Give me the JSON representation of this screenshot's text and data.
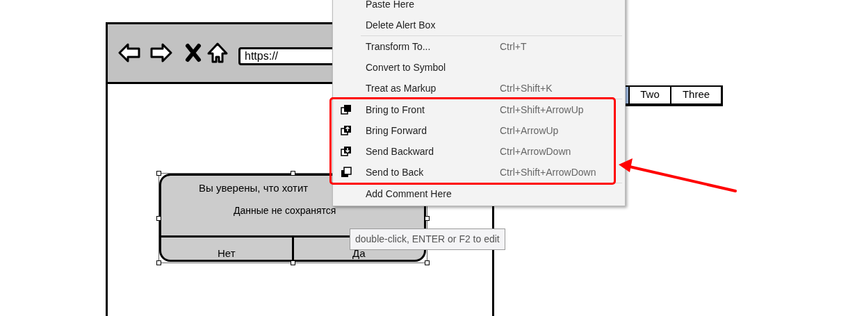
{
  "browser_mockup": {
    "url": "https://",
    "tabs": [
      {
        "selected": true
      },
      {
        "label": "Two",
        "selected": false
      },
      {
        "label": "Three",
        "selected": false
      }
    ]
  },
  "alert_box": {
    "selected": true,
    "title": "Вы уверены, что хотит",
    "message": "Данные не сохранятся",
    "buttons": [
      "Нет",
      "Да"
    ]
  },
  "context_menu": {
    "groups": [
      {
        "highlighted": false,
        "items": [
          {
            "label": "Paste Here",
            "icon": false
          },
          {
            "label": "Delete Alert Box",
            "icon": false
          }
        ]
      },
      {
        "highlighted": false,
        "items": [
          {
            "label": "Transform To...",
            "shortcut": "Ctrl+T",
            "icon": false
          },
          {
            "label": "Convert to Symbol",
            "icon": false
          },
          {
            "label": "Treat as Markup",
            "shortcut": "Ctrl+Shift+K",
            "icon": false
          }
        ]
      },
      {
        "highlighted": true,
        "items": [
          {
            "label": "Bring to Front",
            "shortcut": "Ctrl+Shift+ArrowUp",
            "icon": true
          },
          {
            "label": "Bring Forward",
            "shortcut": "Ctrl+ArrowUp",
            "icon": true
          },
          {
            "label": "Send Backward",
            "shortcut": "Ctrl+ArrowDown",
            "icon": true
          },
          {
            "label": "Send to Back",
            "shortcut": "Ctrl+Shift+ArrowDown",
            "icon": true
          }
        ]
      },
      {
        "highlighted": false,
        "items": [
          {
            "label": "Add Comment Here",
            "icon": false
          }
        ]
      }
    ]
  },
  "tooltip": "double-click, ENTER or F2 to edit"
}
